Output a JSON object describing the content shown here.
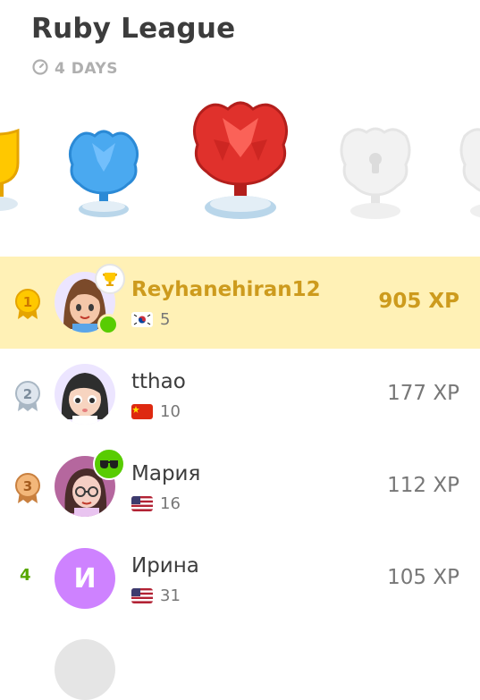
{
  "league": {
    "title": "Ruby League",
    "timer": "4 DAYS"
  },
  "rows": [
    {
      "rank": "1",
      "name": "Reyhanehiran12",
      "streak": "5",
      "xp": "905 XP",
      "flag": "south-korea-flag"
    },
    {
      "rank": "2",
      "name": "tthao",
      "streak": "10",
      "xp": "177 XP",
      "flag": "china-flag"
    },
    {
      "rank": "3",
      "name": "Мария",
      "streak": "16",
      "xp": "112 XP",
      "flag": "usa-flag"
    },
    {
      "rank": "4",
      "name": "Ирина",
      "streak": "31",
      "xp": "105 XP",
      "flag": "usa-flag",
      "initial": "И"
    }
  ],
  "colors": {
    "highlight": "#fff1b6",
    "gold_text": "#cd9b1d",
    "rank4_green": "#58a700",
    "ruby": "#e0312c",
    "sapphire": "#4aa9f0",
    "avatar_purple": "#ce82ff"
  }
}
